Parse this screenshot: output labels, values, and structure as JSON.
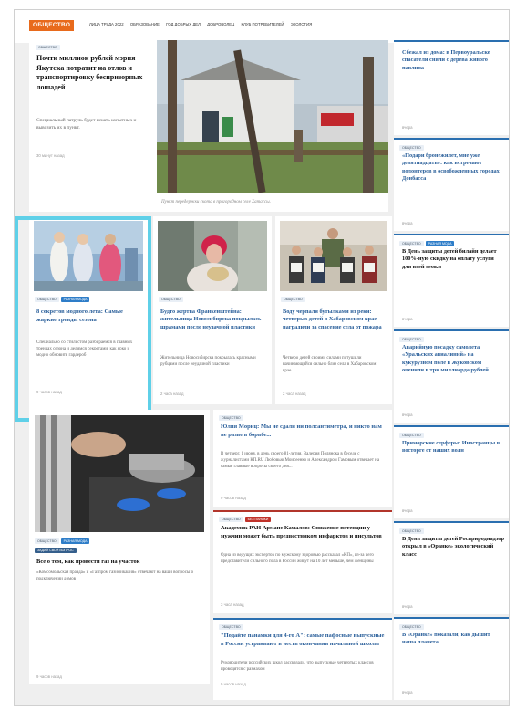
{
  "nav": {
    "rubric": "ОБЩЕСТВО",
    "links": [
      "ЛИЦА ТРУДА 2022",
      "ОБРАЗОВАНИЕ",
      "ГОД ДОБРЫХ ДЕЛ",
      "ДОБРОВОЛЕЦ",
      "КЛУБ ПОТРЕБИТЕЛЕЙ",
      "ЭКОЛОГИЯ"
    ]
  },
  "featured": {
    "tag": "ОБЩЕСТВО",
    "title": "Почти миллион рублей мэрия Якутска потратит на отлов и транспортировку беспризорных лошадей",
    "lead": "Специальный патруль будет искать копытных и вывозить их в пункт.",
    "time": "30 минут назад",
    "caption": "Пункт передержки скота в пригородном селе Хатассы."
  },
  "cards": [
    {
      "tags": [
        "ОБЩЕСТВО",
        "РАЗНАЯ МОДА"
      ],
      "title": "8 секретов модного лета: Самые жаркие тренды сезона",
      "lead": "Специально со стилистом разбираемся в главных трендах сезона и делимся секретами, как ярко и модно обновить гардероб",
      "time": "9 часов назад"
    },
    {
      "tags": [
        "ОБЩЕСТВО"
      ],
      "title": "Будто жертва Франкенштейна: жительница Новосибирска покрылась шрамами после неудачной пластики",
      "lead": "Жительница Новосибирска покрылась красными рубцами после неудачной пластики",
      "time": "2 часа назад"
    },
    {
      "tags": [
        "ОБЩЕСТВО"
      ],
      "title": "Воду черпали бутылками из реки: четверых детей в Хабаровском крае наградили за спасение села от пожара",
      "lead": "Четверо детей своими силами потушили начинающийся сильно близ села в Хабаровском крае",
      "time": "2 часа назад"
    }
  ],
  "gas": {
    "tags": [
      "ОБЩЕСТВО",
      "РАЗНАЯ МОДА"
    ],
    "subtag": "ЗАДАЙ СВОЙ ВОПРОС",
    "title": "Все о том, как провести газ на участок",
    "lead": "«Комсомольская правда» и «Газпром газификация» отвечают на ваши вопросы о подключении домов",
    "time": "9 часов назад"
  },
  "middle": [
    {
      "tags": [
        "ОБЩЕСТВО"
      ],
      "title": "Юлия Мориц: Мы не сдали ни полсантиметра, и никто нам не разве в борьбе...",
      "lead": "В четверг, 1 июня, в день своего 81-летия, Валерия Полянска в беседе с журналистами КП.RU Любовью Моисеенко и Александром Гамовым отвечает на самые главные вопросы своего дня...",
      "time": "9 часов назад"
    },
    {
      "tags": [
        "ОБЩЕСТВО",
        "БЕЗ ПАНИКИ"
      ],
      "title": "Академик РАН Арманс Камалов: Снижение потенции у мужчин может быть предвестником инфарктов и инсультов",
      "lead": "Одна из ведущих экспертов по мужскому здоровью рассказал «КП», из-за чего представители сильного пола в России живут на 10 лет меньше, чем женщины",
      "time": "3 часа назад"
    },
    {
      "tags": [
        "ОБЩЕСТВО"
      ],
      "title": "\"Подайте панамки для 4-го А\": самые пафосные выпускные в России устраивают в честь окончания начальной школы",
      "lead": "Руководители российских школ рассказали, что выпускные четвертых классов проводятся с размахом",
      "time": "9 часов назад"
    }
  ],
  "right": [
    {
      "tags": [],
      "title": "Сбежал из дома: в Первоуральске спасатели сняли с дерева живого павлина",
      "time": "вчера"
    },
    {
      "tags": [
        "ОБЩЕСТВО"
      ],
      "title": "«Подари бронежилет, мне уже девятнадцать»: как встречают волонтеров в освобожденных городах Донбасса",
      "time": "вчера"
    },
    {
      "tags": [
        "ОБЩЕСТВО",
        "РАЗНАЯ МОДА"
      ],
      "title": "В День защиты детей билайн делает 100%-ную скидку на оплату услуги для всей семьи",
      "time": "вчера"
    },
    {
      "tags": [
        "ОБЩЕСТВО"
      ],
      "title": "Аварийную посадку самолета «Уральских авиалиний» на кукурузном поле в Жуковском оценили в три миллиарда рублей",
      "time": "вчера"
    },
    {
      "tags": [
        "ОБЩЕСТВО"
      ],
      "title": "Приморские серферы: Иностранцы в восторге от наших волн",
      "time": "вчера"
    },
    {
      "tags": [
        "ОБЩЕСТВО"
      ],
      "title": "В День защиты детей Росприроднадзор открыл в «Оранке» экологический класс",
      "time": "вчера"
    },
    {
      "tags": [
        "ОБЩЕСТВО"
      ],
      "title": "В «Оранке» показали, как дышит наша планета",
      "time": "вчера"
    }
  ]
}
